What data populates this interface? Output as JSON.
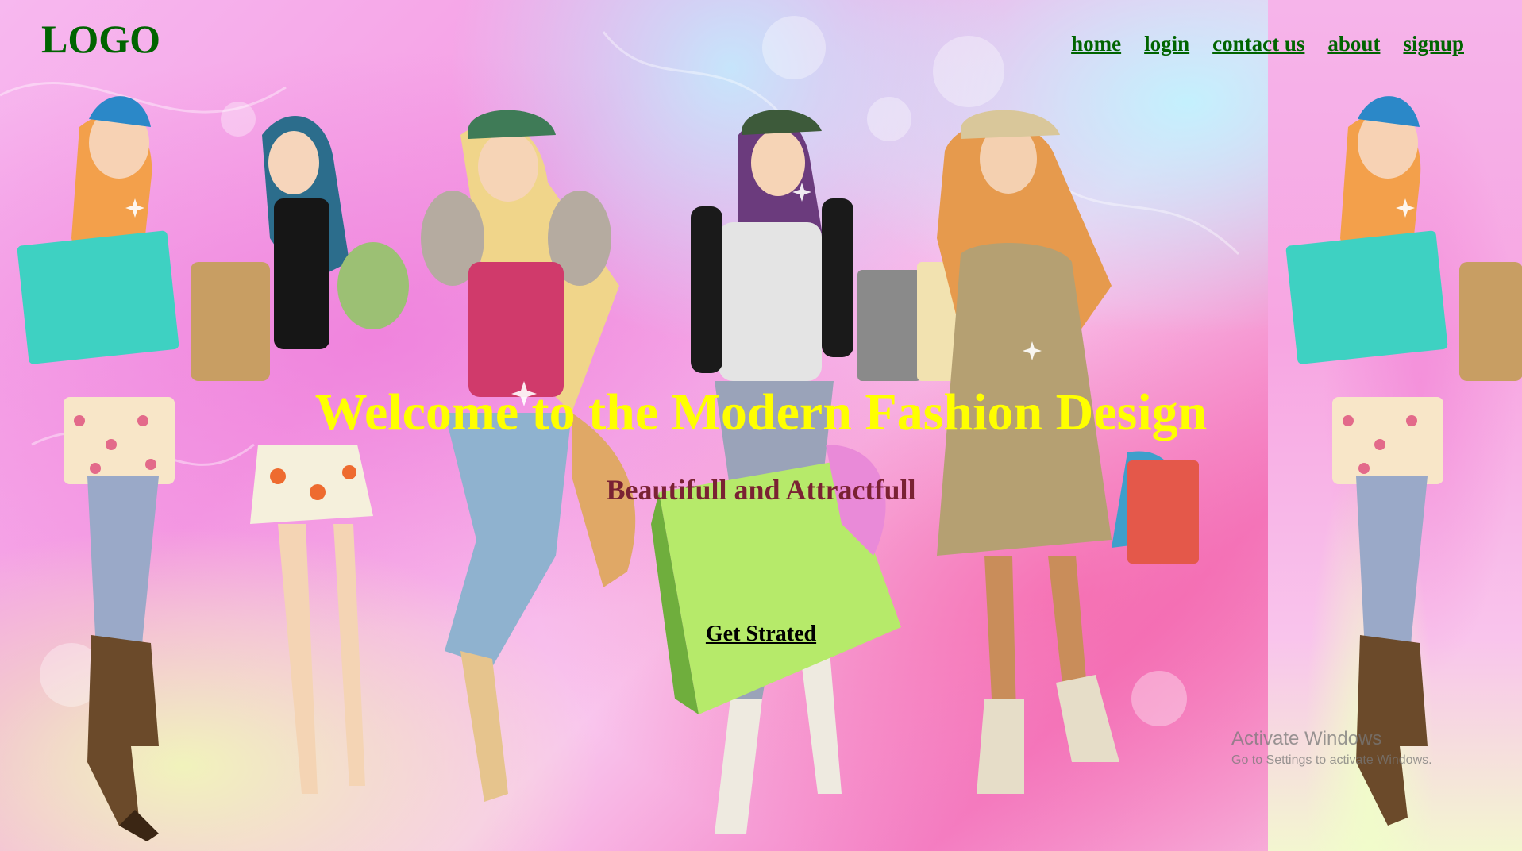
{
  "header": {
    "logo": "LOGO",
    "nav": [
      "home",
      "login",
      "contact us",
      "about",
      "signup"
    ]
  },
  "hero": {
    "headline": "Welcome to the Modern Fashion Design",
    "subheadline": "Beautifull and Attractfull",
    "cta_label": "Get Strated"
  },
  "watermark": {
    "title": "Activate Windows",
    "subtitle": "Go to Settings to activate Windows."
  },
  "colors": {
    "logo": "#006400",
    "nav_link": "#006400",
    "headline": "#ffff00",
    "subheadline": "#7a2233",
    "cta": "#000000",
    "background_accent": "#f59ee4"
  }
}
